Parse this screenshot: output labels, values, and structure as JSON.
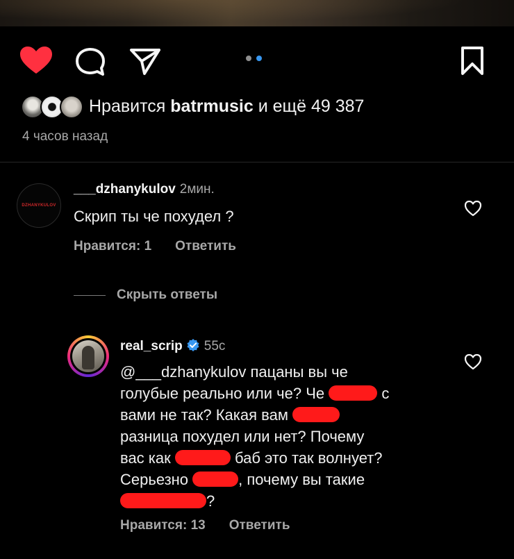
{
  "post": {
    "pager": {
      "active_color": "#3897f0",
      "inactive_color": "#8e8e8e"
    },
    "actions": {
      "like_icon": "heart-filled-icon",
      "comment_icon": "comment-icon",
      "share_icon": "send-icon",
      "save_icon": "bookmark-icon",
      "like_color": "#ff3040"
    },
    "likes": {
      "prefix": "Нравится",
      "user": "batrmusic",
      "suffix": "и ещё 49 387"
    },
    "time_ago": "4 часов назад"
  },
  "comments": [
    {
      "username": "___dzhanykulov",
      "time": "2мин.",
      "avatar_text": "DZHANYKULOV",
      "text": "Скрип ты че похудел ?",
      "likes_label": "Нравится: 1",
      "reply_label": "Ответить",
      "hide_replies_label": "Скрыть ответы",
      "replies": [
        {
          "username": "real_scrip",
          "verified": true,
          "time": "55с",
          "lines": [
            {
              "a": "@___dzhanykulov пацаны вы че"
            },
            {
              "a": "голубые реально или че? Че",
              "b": "с"
            },
            {
              "a": "вами не так? Какая вам",
              "b": ""
            },
            {
              "a": "разница похудел или нет? Почему"
            },
            {
              "a": "вас как",
              "b": "баб это так волнует?"
            },
            {
              "a": "Серьезно",
              "b": ", почему вы такие"
            },
            {
              "a": "",
              "b": "?"
            }
          ],
          "likes_label": "Нравится: 13",
          "reply_label": "Ответить"
        }
      ]
    }
  ]
}
